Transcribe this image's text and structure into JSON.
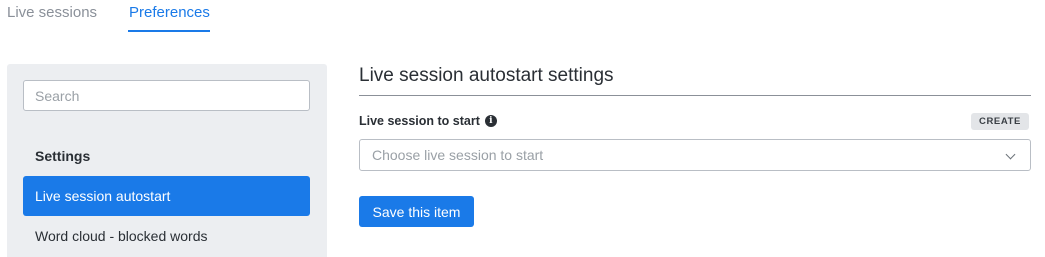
{
  "tabs": [
    {
      "label": "Live sessions",
      "active": false
    },
    {
      "label": "Preferences",
      "active": true
    }
  ],
  "sidebar": {
    "search_placeholder": "Search",
    "heading": "Settings",
    "items": [
      {
        "label": "Live session autostart",
        "active": true
      },
      {
        "label": "Word cloud - blocked words",
        "active": false
      }
    ]
  },
  "main": {
    "title": "Live session autostart settings",
    "field_label": "Live session to start",
    "info_icon": "info-icon",
    "create_label": "CREATE",
    "select_placeholder": "Choose live session to start",
    "save_label": "Save this item"
  },
  "colors": {
    "accent": "#1a7ae8",
    "sidebar_bg": "#eceef1"
  }
}
